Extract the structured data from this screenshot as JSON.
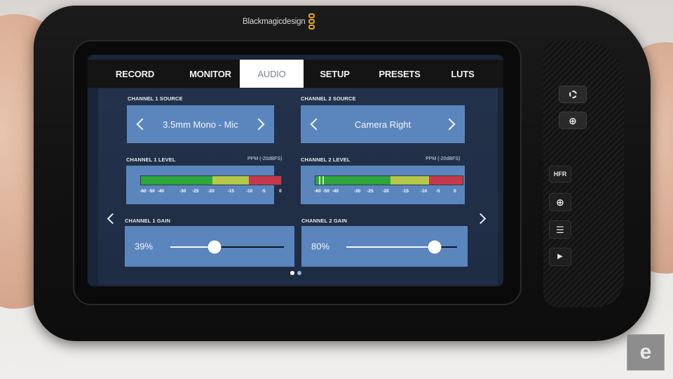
{
  "device": {
    "brand": "Blackmagicdesign"
  },
  "tabs": [
    {
      "label": "RECORD",
      "active": false
    },
    {
      "label": "MONITOR",
      "active": false
    },
    {
      "label": "AUDIO",
      "active": true
    },
    {
      "label": "SETUP",
      "active": false
    },
    {
      "label": "PRESETS",
      "active": false
    },
    {
      "label": "LUTS",
      "active": false
    }
  ],
  "audio": {
    "channel1": {
      "source_label": "CHANNEL 1 SOURCE",
      "source_value": "3.5mm Mono - Mic",
      "level_label": "CHANNEL 1 LEVEL",
      "level_scale": "PPM (-20dBFS)",
      "gain_label": "CHANNEL 1 GAIN",
      "gain_value": "39%",
      "gain_fraction": 0.39,
      "peak_db": null
    },
    "channel2": {
      "source_label": "CHANNEL 2 SOURCE",
      "source_value": "Camera Right",
      "level_label": "CHANNEL 2 LEVEL",
      "level_scale": "PPM (-20dBFS)",
      "gain_label": "CHANNEL 2 GAIN",
      "gain_value": "80%",
      "gain_fraction": 0.8,
      "peak_db": [
        -59,
        -55
      ]
    },
    "meter_ticks": [
      "-60",
      "-50",
      "-40",
      "-30",
      "-25",
      "-20",
      "-15",
      "-10",
      "-5",
      "0"
    ],
    "meter_zones": {
      "green": "#2fa63c",
      "yellow": "#b4c84a",
      "red": "#c7384a"
    }
  },
  "pagination": {
    "current": 1,
    "total": 2
  },
  "hardware_buttons": {
    "iris_icon": "aperture-icon",
    "focus_icon": "focus-crosshair-icon",
    "hfr_label": "HFR",
    "zoom_icon": "zoom-in-icon",
    "menu_icon": "menu-icon",
    "play_icon": "play-icon"
  },
  "watermark": {
    "text": "e"
  }
}
